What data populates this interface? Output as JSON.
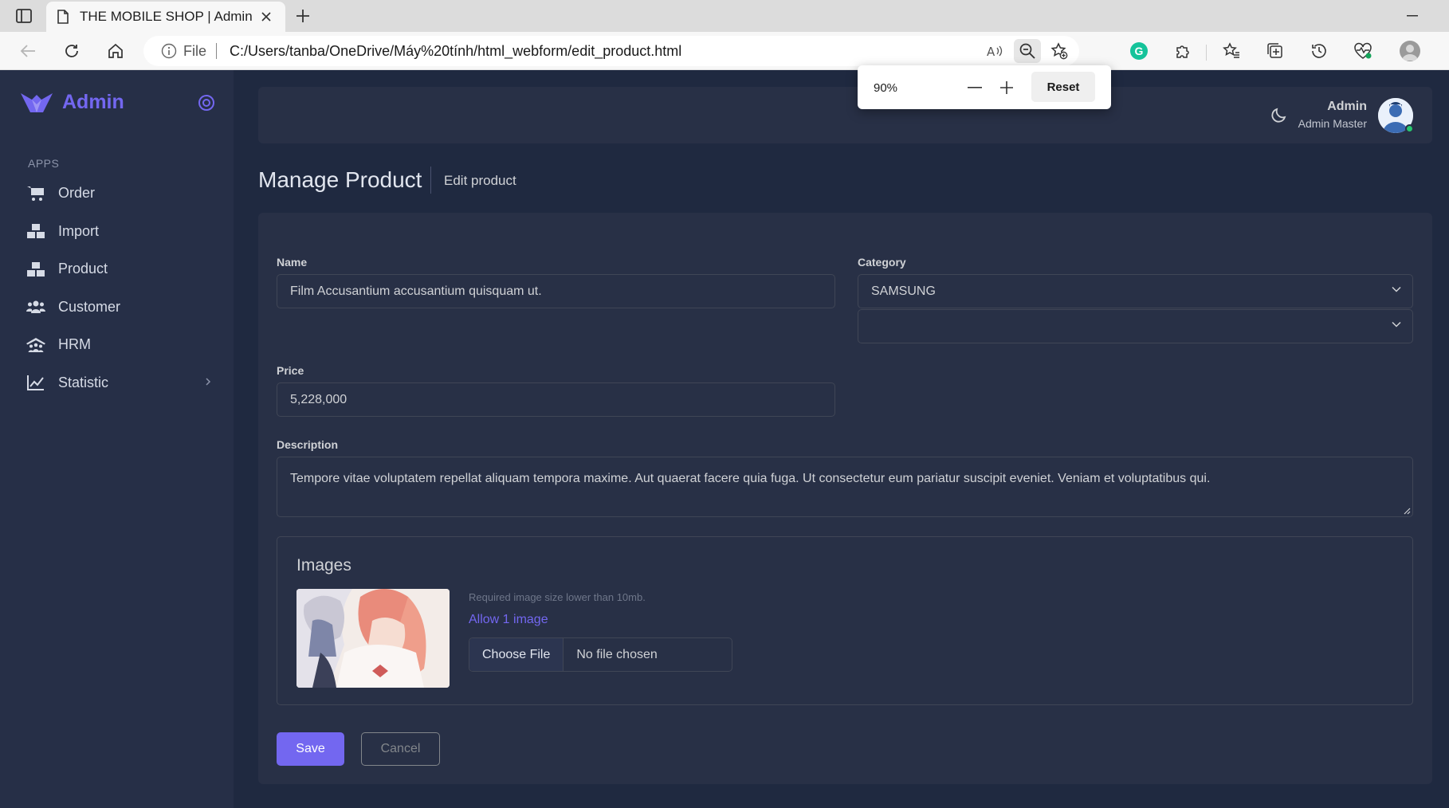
{
  "browser": {
    "tab_title": "THE MOBILE SHOP | Admin",
    "address_scheme": "File",
    "address_url": "C:/Users/tanba/OneDrive/Máy%20tính/html_webform/edit_product.html",
    "zoom": {
      "value": "90%",
      "reset_label": "Reset"
    },
    "grammarly_letter": "G"
  },
  "sidebar": {
    "brand": "Admin",
    "section_header": "APPS",
    "items": [
      {
        "label": "Order",
        "icon": "cart-icon"
      },
      {
        "label": "Import",
        "icon": "boxes-icon"
      },
      {
        "label": "Product",
        "icon": "boxes-icon"
      },
      {
        "label": "Customer",
        "icon": "users-icon"
      },
      {
        "label": "HRM",
        "icon": "people-roof-icon"
      },
      {
        "label": "Statistic",
        "icon": "chart-line-icon",
        "has_submenu": true
      }
    ]
  },
  "navbar": {
    "user_name": "Admin",
    "user_role": "Admin Master",
    "status_color": "#28c76f"
  },
  "page": {
    "title": "Manage Product",
    "subtitle": "Edit product"
  },
  "form": {
    "name_label": "Name",
    "name_value": "Film Accusantium accusantium quisquam ut.",
    "category_label": "Category",
    "category_value": "SAMSUNG",
    "subcategory_value": "",
    "price_label": "Price",
    "price_value": "5,228,000",
    "description_label": "Description",
    "description_value": "Tempore vitae voluptatem repellat aliquam tempora maxime. Aut quaerat facere quia fuga. Ut consectetur eum pariatur suscipit eveniet. Veniam et voluptatibus qui.",
    "images": {
      "title": "Images",
      "note": "Required image size lower than 10mb.",
      "allow": "Allow 1 image",
      "choose_label": "Choose File",
      "file_status": "No file chosen"
    },
    "save_label": "Save",
    "cancel_label": "Cancel"
  },
  "colors": {
    "accent": "#7367f0",
    "sidebar_bg": "#262f47",
    "body_bg": "#1f2940",
    "card_bg": "#283046"
  }
}
